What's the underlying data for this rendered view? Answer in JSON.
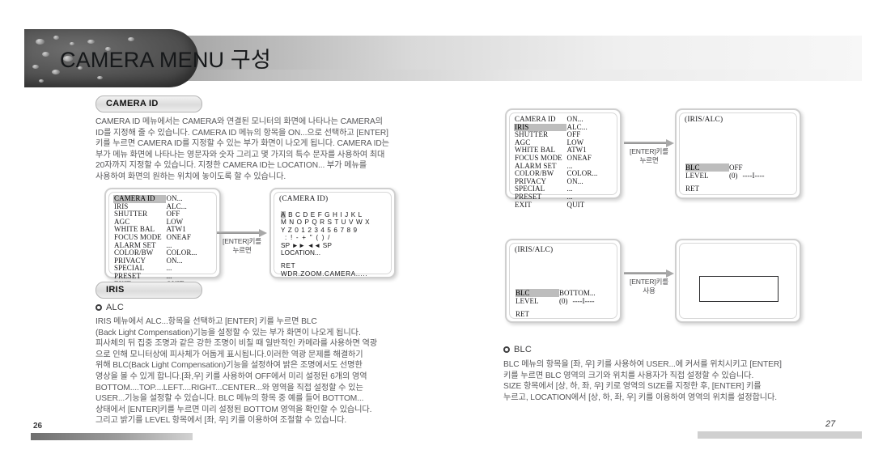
{
  "header": {
    "title": "CAMERA MENU 구성"
  },
  "left_page": {
    "section_camera_id": {
      "pill_label": "CAMERA ID",
      "paragraph": "CAMERA ID 메뉴에서는 CAMERA와 연결된 모니터의 화면에 나타나는 CAMERA의\nID를 지정해 줄 수 있습니다. CAMERA ID 메뉴의 항목을 ON...으로 선택하고 [ENTER]\n키를 누르면 CAMERA ID를 지정할 수 있는 부가 화면이 나오게 됩니다. CAMERA ID는\n부가 메뉴 화면에 나타나는 영문자와 숫자 그리고 몇 가지의 특수 문자를 사용하여 최대\n20자까지 지정할 수 있습니다. 지정한 CAMERA ID는 LOCATION... 부가 메뉴를\n사용하여 화면의 원하는 위치에 놓이도록 할 수 있습니다."
    },
    "main_menu": {
      "rows": [
        {
          "label": "CAMERA ID",
          "value": "ON...",
          "highlight": true
        },
        {
          "label": "IRIS",
          "value": "ALC...",
          "highlight": false
        },
        {
          "label": "SHUTTER",
          "value": "OFF",
          "highlight": false
        },
        {
          "label": "AGC",
          "value": "LOW",
          "highlight": false
        },
        {
          "label": "WHITE BAL",
          "value": "ATW1",
          "highlight": false
        },
        {
          "label": "FOCUS MODE",
          "value": "ONEAF",
          "highlight": false
        },
        {
          "label": "ALARM SET",
          "value": "...",
          "highlight": false
        },
        {
          "label": "COLOR/BW",
          "value": "COLOR...",
          "highlight": false
        },
        {
          "label": "PRIVACY",
          "value": "ON...",
          "highlight": false
        },
        {
          "label": "SPECIAL",
          "value": "...",
          "highlight": false
        },
        {
          "label": "PRESET",
          "value": "...",
          "highlight": false
        },
        {
          "label": "EXIT",
          "value": "QUIT",
          "highlight": false
        }
      ]
    },
    "arrow_label": "[ENTER]키를\n누르면",
    "camera_id_screen": {
      "title": "(CAMERA ID)",
      "row1_first": "A",
      "row1_rest": "B C D E F G H I J K L",
      "row2": "M N O P Q R S T U V W X",
      "row3": "Y Z 0 1 2 3 4 5 6 7 8 9",
      "row4": ":  !  -  +  \"  (  )  /",
      "row5": "SP ►► ◄◄ SP",
      "row6": "LOCATION...",
      "row7": "RET",
      "row8": "WDR.ZOOM.CAMERA....."
    },
    "section_iris": {
      "pill_label": "IRIS",
      "bullet_label": "ALC",
      "paragraph": "IRIS 메뉴에서 ALC...항목을 선택하고 [ENTER] 키를 누르면 BLC\n(Back Light Compensation)기능을 설정할 수 있는 부가 화면이 나오게 됩니다.\n피사체의 뒤 집중 조명과 같은 강한 조명이 비칠 때 일반적인 카메라를 사용하면 역광\n으로 인해 모니터상에 피사체가 어둡게 표시됩니다.이러한 역광 문제를 해결하기\n위해 BLC(Back Light Compensation)기능을 설정하여 밝은 조명에서도 선명한\n영상을 볼 수 있게 합니다.[좌,우] 키를 사용하여 OFF에서 미리 설정된 6개의 영역\nBOTTOM....TOP....LEFT....RIGHT...CENTER...와 영역을 직접 설정할 수 있는\nUSER...기능을 설정할 수 있습니다. BLC 메뉴의 항목 중 예를 들어 BOTTOM...\n상태에서 [ENTER]키를 누르면 미리 설정된 BOTTOM 영역을 확인할 수 있습니다.\n그리고 밝기를 LEVEL 항목에서 [좌, 우] 키를 이용하여 조절할 수 있습니다."
    },
    "page_number": "26"
  },
  "right_page": {
    "main_menu": {
      "rows": [
        {
          "label": "CAMERA ID",
          "value": "ON...",
          "highlight": false
        },
        {
          "label": "IRIS",
          "value": "ALC...",
          "highlight": true
        },
        {
          "label": "SHUTTER",
          "value": "OFF",
          "highlight": false
        },
        {
          "label": "AGC",
          "value": "LOW",
          "highlight": false
        },
        {
          "label": "WHITE BAL",
          "value": "ATW1",
          "highlight": false
        },
        {
          "label": "FOCUS MODE",
          "value": "ONEAF",
          "highlight": false
        },
        {
          "label": "ALARM SET",
          "value": "...",
          "highlight": false
        },
        {
          "label": "COLOR/BW",
          "value": "COLOR...",
          "highlight": false
        },
        {
          "label": "PRIVACY",
          "value": "ON...",
          "highlight": false
        },
        {
          "label": "SPECIAL",
          "value": "...",
          "highlight": false
        },
        {
          "label": "PRESET",
          "value": "...",
          "highlight": false
        },
        {
          "label": "EXIT",
          "value": "QUIT",
          "highlight": false
        }
      ]
    },
    "arrow1_label": "[ENTER]키를\n누르면",
    "arrow2_label": "[ENTER]키를\n사용",
    "iris_alc_screen_1": {
      "title": "(IRIS/ALC)",
      "blc_key": "BLC",
      "blc_value": "OFF",
      "level_key": "LEVEL",
      "level_value": "(0)",
      "level_gauge": "----I----",
      "ret": "RET"
    },
    "iris_alc_screen_2": {
      "title": "(IRIS/ALC)",
      "blc_key": "BLC",
      "blc_value": "BOTTOM...",
      "level_key": "LEVEL",
      "level_value": "(0)",
      "level_gauge": "----I----",
      "ret": "RET"
    },
    "section_blc": {
      "bullet_label": "BLC",
      "paragraph": "BLC 메뉴의 항목을 [좌, 우] 키를 사용하여 USER...에 커서를 위치시키고 [ENTER]\n키를 누르면 BLC 영역의 크기와 위치를 사용자가 직접 설정할 수 있습니다.\nSIZE 항목에서 [상, 하, 좌, 우] 키로 영역의 SIZE를 지정한 후, [ENTER] 키를\n누르고, LOCATION에서 [상, 하, 좌, 우] 키를 이용하여 영역의 위치를 설정합니다."
    },
    "page_number": "27"
  }
}
